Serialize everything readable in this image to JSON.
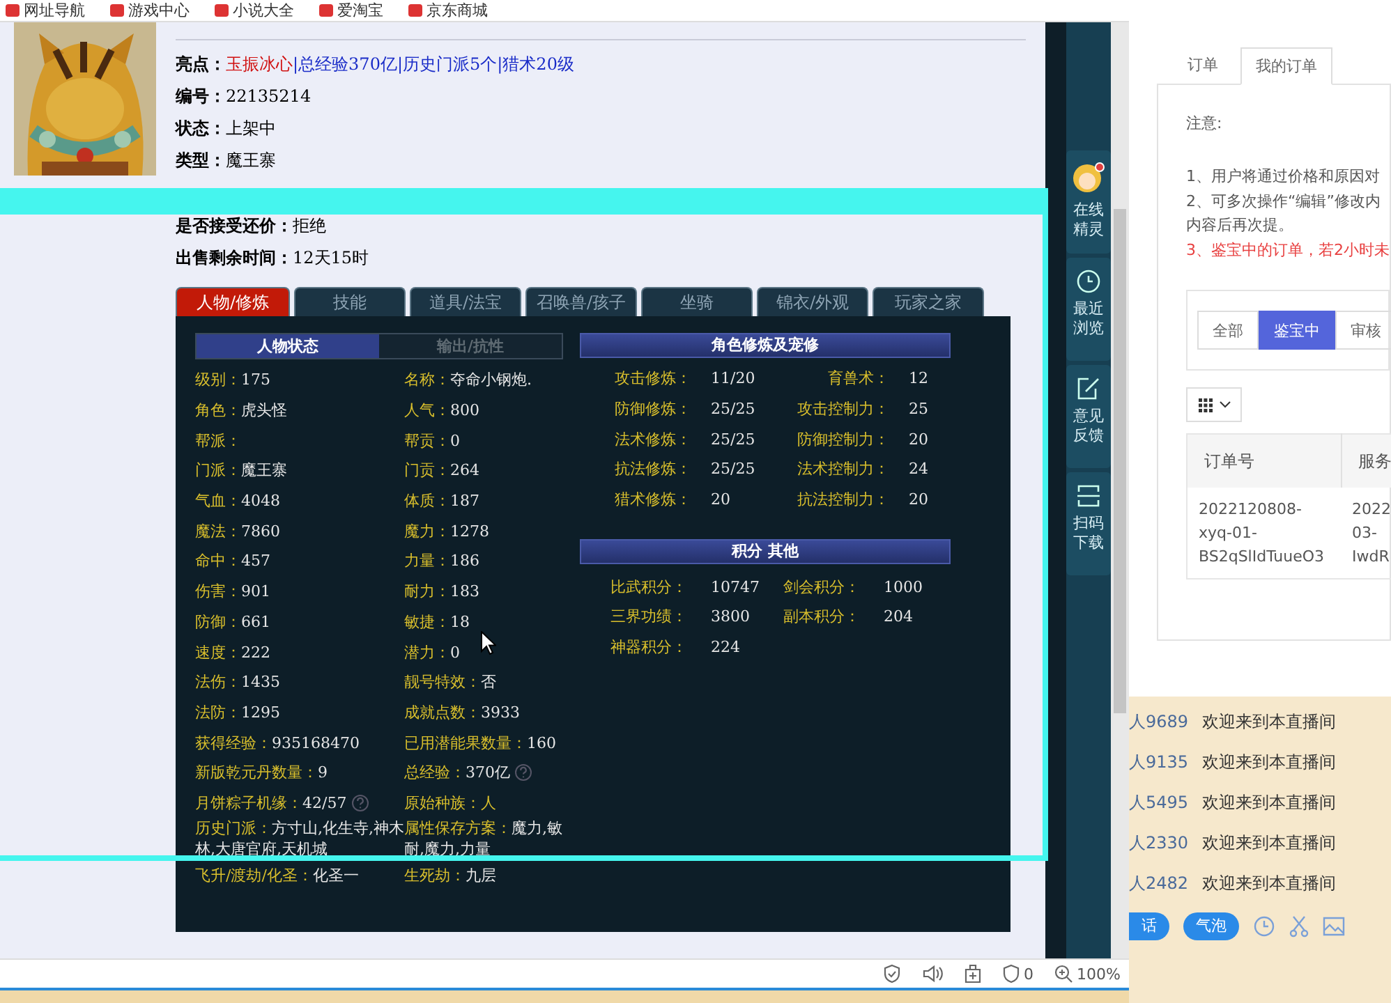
{
  "bookmarks": [
    {
      "label": "网址导航"
    },
    {
      "label": "游戏中心"
    },
    {
      "label": "小说大全"
    },
    {
      "label": "爱淘宝"
    },
    {
      "label": "京东商城"
    }
  ],
  "listing": {
    "highlights": {
      "label": "亮点：",
      "parts": [
        {
          "text": "玉振冰心",
          "kind": "special"
        },
        {
          "text": "|总经验370亿",
          "kind": "normal"
        },
        {
          "text": "|历史门派5个",
          "kind": "normal"
        },
        {
          "text": "|猎术20级",
          "kind": "normal"
        }
      ]
    },
    "fields": [
      {
        "label": "编号：",
        "value": "22135214"
      },
      {
        "label": "状态：",
        "value": "上架中"
      },
      {
        "label": "类型：",
        "value": "魔王寨"
      }
    ],
    "fields_after": [
      {
        "label": "是否接受还价：",
        "value": "拒绝"
      },
      {
        "label": "出售剩余时间：",
        "value": "12天15时"
      }
    ],
    "tabs": [
      {
        "label": "人物/修炼",
        "selected": true
      },
      {
        "label": "技能",
        "selected": false
      },
      {
        "label": "道具/法宝",
        "selected": false
      },
      {
        "label": "召唤兽/孩子",
        "selected": false
      },
      {
        "label": "坐骑",
        "selected": false
      },
      {
        "label": "锦衣/外观",
        "selected": false
      },
      {
        "label": "玩家之家",
        "selected": false
      }
    ],
    "subtabs": [
      {
        "label": "人物状态",
        "selected": true
      },
      {
        "label": "输出/抗性",
        "selected": false
      }
    ],
    "stats": [
      {
        "left": {
          "label": "级别：",
          "value": "175"
        },
        "right": {
          "label": "名称：",
          "value": "夺命小钢炮."
        }
      },
      {
        "left": {
          "label": "角色：",
          "value": "虎头怪"
        },
        "right": {
          "label": "人气：",
          "value": "800"
        }
      },
      {
        "left": {
          "label": "帮派："
        },
        "right": {
          "label": "帮贡：",
          "value": "0"
        }
      },
      {
        "left": {
          "label": "门派：",
          "value": "魔王寨"
        },
        "right": {
          "label": "门贡：",
          "value": "264"
        }
      },
      {
        "left": {
          "label": "气血：",
          "value": "4048"
        },
        "right": {
          "label": "体质：",
          "value": "187"
        }
      },
      {
        "left": {
          "label": "魔法：",
          "value": "7860"
        },
        "right": {
          "label": "魔力：",
          "value": "1278"
        }
      },
      {
        "left": {
          "label": "命中：",
          "value": "457"
        },
        "right": {
          "label": "力量：",
          "value": "186"
        }
      },
      {
        "left": {
          "label": "伤害：",
          "value": "901"
        },
        "right": {
          "label": "耐力：",
          "value": "183"
        }
      },
      {
        "left": {
          "label": "防御：",
          "value": "661"
        },
        "right": {
          "label": "敏捷：",
          "value": "18"
        }
      },
      {
        "left": {
          "label": "速度：",
          "value": "222"
        },
        "right": {
          "label": "潜力：",
          "value": "0"
        }
      },
      {
        "left": {
          "label": "法伤：",
          "value": "1435"
        },
        "right": {
          "label": "靓号特效：",
          "value": "否"
        }
      },
      {
        "left": {
          "label": "法防：",
          "value": "1295"
        },
        "right": {
          "label": "成就点数：",
          "value": "3933"
        }
      },
      {
        "left": {
          "label": "获得经验：",
          "value": "935168470"
        },
        "right": {
          "label": "已用潜能果数量：",
          "value": "160"
        }
      },
      {
        "left": {
          "label": "新版乾元丹数量：",
          "value": "9"
        },
        "right": {
          "label": "总经验：",
          "value": "370亿",
          "help": true
        }
      },
      {
        "left": {
          "label": "月饼粽子机缘：",
          "value": "42/57",
          "help": true
        },
        "right": {
          "label": "原始种族：",
          "value": "人",
          "accent": true
        }
      },
      {
        "left": {
          "label": "历史门派：",
          "value": "方寸山,化生寺,神木林,大唐官府,天机城"
        },
        "right": {
          "label": "属性保存方案：",
          "value": "魔力,敏耐,魔力,力量"
        }
      },
      {
        "left": {
          "label": "飞升/渡劫/化圣：",
          "value": "化圣一"
        },
        "right": {
          "label": "生死劫：",
          "value": "九层"
        }
      }
    ],
    "cultivation": {
      "title": "角色修炼及宠修",
      "rows": [
        {
          "left": {
            "label": "攻击修炼：",
            "value": "11/20"
          },
          "right": {
            "label": "育兽术：",
            "value": "12"
          }
        },
        {
          "left": {
            "label": "防御修炼：",
            "value": "25/25"
          },
          "right": {
            "label": "攻击控制力：",
            "value": "25"
          }
        },
        {
          "left": {
            "label": "法术修炼：",
            "value": "25/25"
          },
          "right": {
            "label": "防御控制力：",
            "value": "20"
          }
        },
        {
          "left": {
            "label": "抗法修炼：",
            "value": "25/25"
          },
          "right": {
            "label": "法术控制力：",
            "value": "24"
          }
        },
        {
          "left": {
            "label": "猎术修炼：",
            "value": "20"
          },
          "right": {
            "label": "抗法控制力：",
            "value": "20"
          }
        }
      ]
    },
    "points": {
      "title": "积分 其他",
      "rows": [
        {
          "left": {
            "label": "比武积分：",
            "value": "10747"
          },
          "right": {
            "label": "剑会积分：",
            "value": "1000"
          }
        },
        {
          "left": {
            "label": "三界功绩：",
            "value": "3800"
          },
          "right": {
            "label": "副本积分：",
            "value": "204"
          }
        },
        {
          "left": {
            "label": "神器积分：",
            "value": "224"
          }
        }
      ]
    }
  },
  "sidebar": [
    {
      "kind": "avatar",
      "label": "在线精灵"
    },
    {
      "kind": "clock",
      "label": "最近浏览"
    },
    {
      "kind": "edit",
      "label": "意见反馈"
    },
    {
      "kind": "scan",
      "label": "扫码下载"
    }
  ],
  "orders": {
    "tabs": [
      {
        "label": "订单",
        "selected": false
      },
      {
        "label": "我的订单",
        "selected": true
      }
    ],
    "notice_title": "注意:",
    "notices": [
      {
        "text": "1、用户将通过价格和原因对",
        "kind": "normal"
      },
      {
        "text": "2、可多次操作“编辑”修改内",
        "kind": "normal"
      },
      {
        "text": "内容后再次提。",
        "kind": "normal"
      },
      {
        "text": "3、鉴宝中的订单，若2小时未",
        "kind": "warning"
      }
    ],
    "filters": [
      {
        "label": "全部",
        "selected": false
      },
      {
        "label": "鉴宝中",
        "selected": true
      },
      {
        "label": "审核",
        "selected": false
      }
    ],
    "table": {
      "columns": [
        "订单号",
        "服务"
      ],
      "rows": [
        [
          "2022120808-\nxyq-01-\nBS2qSlIdTuueO3",
          "2022\n03-\nIwdR"
        ]
      ]
    }
  },
  "chat": {
    "messages": [
      {
        "user": "人9689",
        "text": "欢迎来到本直播间"
      },
      {
        "user": "人9135",
        "text": "欢迎来到本直播间"
      },
      {
        "user": "人5495",
        "text": "欢迎来到本直播间"
      },
      {
        "user": "人2330",
        "text": "欢迎来到本直播间"
      },
      {
        "user": "人2482",
        "text": "欢迎来到本直播间"
      }
    ],
    "buttons": [
      {
        "label": "话"
      },
      {
        "label": "气泡"
      }
    ]
  },
  "status_bar": {
    "blocked_count": "0",
    "zoom": "100%"
  }
}
